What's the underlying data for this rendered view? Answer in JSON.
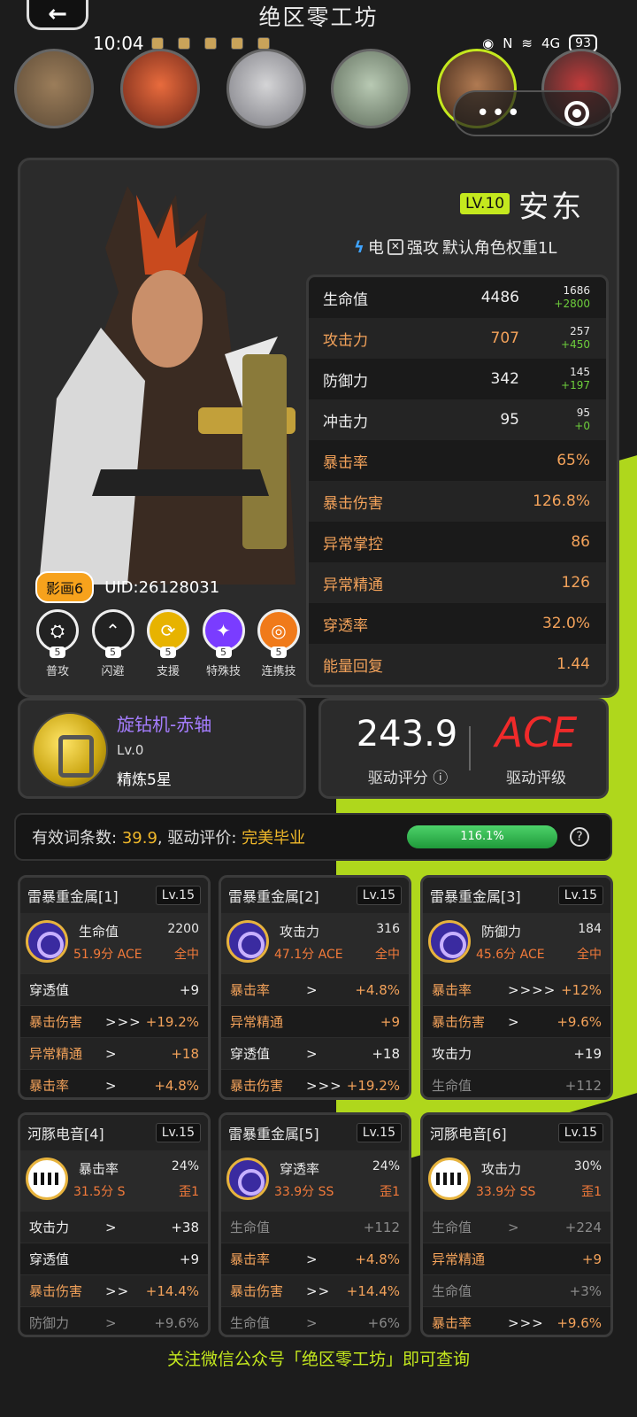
{
  "app": {
    "title": "绝区零工坊",
    "back": "←"
  },
  "status": {
    "time": "10:04",
    "battery": "93",
    "net": "4G"
  },
  "character": {
    "level": "LV.10",
    "name": "安东",
    "element": "电",
    "style": "强攻",
    "weight": "默认角色权重1L",
    "cinema": "影画6",
    "uid": "UID:26128031"
  },
  "stats": [
    {
      "label": "生命值",
      "value": "4486",
      "base": "1686",
      "add": "+2800",
      "color": "white"
    },
    {
      "label": "攻击力",
      "value": "707",
      "base": "257",
      "add": "+450",
      "color": "orange"
    },
    {
      "label": "防御力",
      "value": "342",
      "base": "145",
      "add": "+197",
      "color": "white"
    },
    {
      "label": "冲击力",
      "value": "95",
      "base": "95",
      "add": "+0",
      "color": "white"
    },
    {
      "label": "暴击率",
      "value": "65%",
      "color": "orange"
    },
    {
      "label": "暴击伤害",
      "value": "126.8%",
      "color": "orange"
    },
    {
      "label": "异常掌控",
      "value": "86",
      "color": "orange"
    },
    {
      "label": "异常精通",
      "value": "126",
      "color": "orange"
    },
    {
      "label": "穿透率",
      "value": "32.0%",
      "color": "orange"
    },
    {
      "label": "能量回复",
      "value": "1.44",
      "color": "orange"
    }
  ],
  "skills": [
    {
      "name": "普攻",
      "level": "5",
      "icon": "basic-attack-icon"
    },
    {
      "name": "闪避",
      "level": "5",
      "icon": "dodge-icon"
    },
    {
      "name": "支援",
      "level": "5",
      "icon": "assist-icon"
    },
    {
      "name": "特殊技",
      "level": "5",
      "icon": "special-icon"
    },
    {
      "name": "连携技",
      "level": "5",
      "icon": "chain-icon"
    }
  ],
  "engine": {
    "name": "旋钻机-赤轴",
    "level": "Lv.0",
    "refine": "精炼5星"
  },
  "score": {
    "value": "243.9",
    "label": "驱动评分",
    "grade": "ACE",
    "grade_label": "驱动评级"
  },
  "eval": {
    "count_label": "有效词条数:",
    "count": "39.9",
    "sep": ",",
    "eval_label": "驱动评价:",
    "eval": "完美毕业",
    "progress": "116.1%",
    "progress_fraction": 1.0
  },
  "discs": [
    {
      "title": "雷暴重金属[1]",
      "lv": "Lv.15",
      "set": "set1",
      "main": "生命值",
      "main_val": "2200",
      "score": "51.9分 ACE",
      "hit": "全中",
      "subs": [
        [
          "穿透值",
          "",
          "+9",
          ""
        ],
        [
          "暴击伤害",
          ">>>",
          "+19.2%",
          "orange"
        ],
        [
          "异常精通",
          ">",
          "+18",
          "orange"
        ],
        [
          "暴击率",
          ">",
          "+4.8%",
          "orange"
        ]
      ]
    },
    {
      "title": "雷暴重金属[2]",
      "lv": "Lv.15",
      "set": "set1",
      "main": "攻击力",
      "main_val": "316",
      "score": "47.1分 ACE",
      "hit": "全中",
      "subs": [
        [
          "暴击率",
          ">",
          "+4.8%",
          "orange"
        ],
        [
          "异常精通",
          "",
          "+9",
          "orange"
        ],
        [
          "穿透值",
          ">",
          "+18",
          ""
        ],
        [
          "暴击伤害",
          ">>>",
          "+19.2%",
          "orange"
        ]
      ]
    },
    {
      "title": "雷暴重金属[3]",
      "lv": "Lv.15",
      "set": "set1",
      "main": "防御力",
      "main_val": "184",
      "score": "45.6分 ACE",
      "hit": "全中",
      "subs": [
        [
          "暴击率",
          ">>>>",
          "+12%",
          "orange"
        ],
        [
          "暴击伤害",
          ">",
          "+9.6%",
          "orange"
        ],
        [
          "攻击力",
          "",
          "+19",
          ""
        ],
        [
          "生命值",
          "",
          "+112",
          "dim"
        ]
      ]
    },
    {
      "title": "河豚电音[4]",
      "lv": "Lv.15",
      "set": "set2",
      "main": "暴击率",
      "main_val": "24%",
      "score": "31.5分 S",
      "hit": "歪1",
      "subs": [
        [
          "攻击力",
          ">",
          "+38",
          ""
        ],
        [
          "穿透值",
          "",
          "+9",
          ""
        ],
        [
          "暴击伤害",
          ">>",
          "+14.4%",
          "orange"
        ],
        [
          "防御力",
          ">",
          "+9.6%",
          "dim"
        ]
      ]
    },
    {
      "title": "雷暴重金属[5]",
      "lv": "Lv.15",
      "set": "set1",
      "main": "穿透率",
      "main_val": "24%",
      "score": "33.9分 SS",
      "hit": "歪1",
      "subs": [
        [
          "生命值",
          "",
          "+112",
          "dim"
        ],
        [
          "暴击率",
          ">",
          "+4.8%",
          "orange"
        ],
        [
          "暴击伤害",
          ">>",
          "+14.4%",
          "orange"
        ],
        [
          "生命值",
          ">",
          "+6%",
          "dim"
        ]
      ]
    },
    {
      "title": "河豚电音[6]",
      "lv": "Lv.15",
      "set": "set2",
      "main": "攻击力",
      "main_val": "30%",
      "score": "33.9分 SS",
      "hit": "歪1",
      "subs": [
        [
          "生命值",
          ">",
          "+224",
          "dim"
        ],
        [
          "异常精通",
          "",
          "+9",
          "orange"
        ],
        [
          "生命值",
          "",
          "+3%",
          "dim"
        ],
        [
          "暴击率",
          ">>>",
          "+9.6%",
          "orange"
        ]
      ]
    }
  ],
  "footer": "关注微信公众号「绝区零工坊」即可查询"
}
